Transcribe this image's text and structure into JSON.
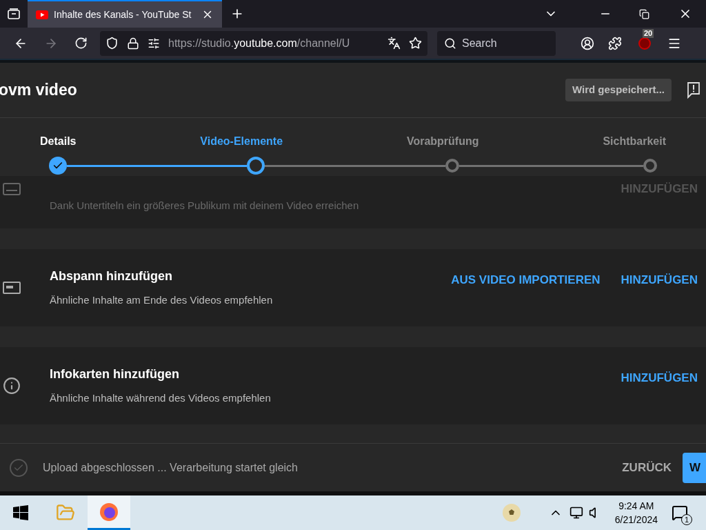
{
  "browser": {
    "tab_title": "Inhalte des Kanals - YouTube St",
    "url_prefix": "https://studio.",
    "url_domain": "youtube.com",
    "url_rest": "/channel/U",
    "search_placeholder": "Search",
    "extension_badge": "20"
  },
  "dialog": {
    "title": "ovm video",
    "save_status": "Wird gespeichert..."
  },
  "steps": [
    {
      "label": "Details",
      "completed": true,
      "selected": false
    },
    {
      "label": "Video-Elemente",
      "completed": false,
      "selected": true
    },
    {
      "label": "Vorabprüfung",
      "completed": false,
      "selected": false
    },
    {
      "label": "Sichtbarkeit",
      "completed": false,
      "selected": false
    }
  ],
  "rows": [
    {
      "kind": "subtitles",
      "description": "Dank Untertiteln ein größeres Publikum mit deinem Video erreichen",
      "actions": [
        "HINZUFÜGEN"
      ],
      "faded": true
    },
    {
      "kind": "endscreen",
      "title": "Abspann hinzufügen",
      "description": "Ähnliche Inhalte am Ende des Videos empfehlen",
      "actions": [
        "AUS VIDEO IMPORTIEREN",
        "HINZUFÜGEN"
      ],
      "faded": false
    },
    {
      "kind": "cards",
      "title": "Infokarten hinzufügen",
      "description": "Ähnliche Inhalte während des Videos empfehlen",
      "actions": [
        "HINZUFÜGEN"
      ],
      "faded": false
    }
  ],
  "footer": {
    "status": "Upload abgeschlossen ... Verarbeitung startet gleich",
    "back": "ZURÜCK",
    "next": "W"
  },
  "taskbar": {
    "time": "9:24 AM",
    "date": "6/21/2024",
    "notifications": "1"
  }
}
